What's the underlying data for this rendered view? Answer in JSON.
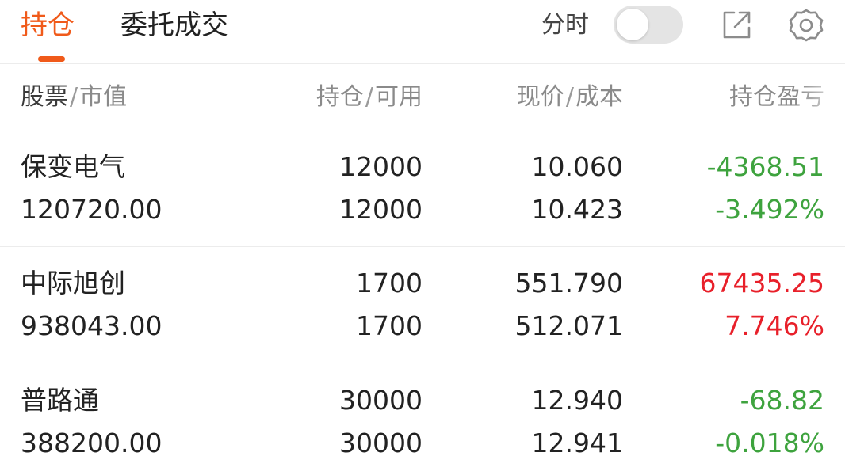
{
  "tabs": {
    "positions": "持仓",
    "orders": "委托成交"
  },
  "toolbar": {
    "timeshare_label": "分时",
    "timeshare_enabled": false,
    "share_icon": "share-external-icon",
    "settings_icon": "gear-icon"
  },
  "colors": {
    "accent": "#f05a1a",
    "loss": "#3ea33e",
    "gain": "#e8202a"
  },
  "header": {
    "stock": "股票",
    "market_value": "市值",
    "holding": "持仓",
    "available": "可用",
    "price": "现价",
    "cost": "成本",
    "pnl": "持仓盈亏",
    "sep": "/"
  },
  "positions": [
    {
      "name": "保变电气",
      "market_value": "120720.00",
      "holding": "12000",
      "available": "12000",
      "price": "10.060",
      "cost": "10.423",
      "pnl": "-4368.51",
      "pnl_pct": "-3.492%",
      "trend": "loss"
    },
    {
      "name": "中际旭创",
      "market_value": "938043.00",
      "holding": "1700",
      "available": "1700",
      "price": "551.790",
      "cost": "512.071",
      "pnl": "67435.25",
      "pnl_pct": "7.746%",
      "trend": "gain"
    },
    {
      "name": "普路通",
      "market_value": "388200.00",
      "holding": "30000",
      "available": "30000",
      "price": "12.940",
      "cost": "12.941",
      "pnl": "-68.82",
      "pnl_pct": "-0.018%",
      "trend": "loss"
    }
  ]
}
